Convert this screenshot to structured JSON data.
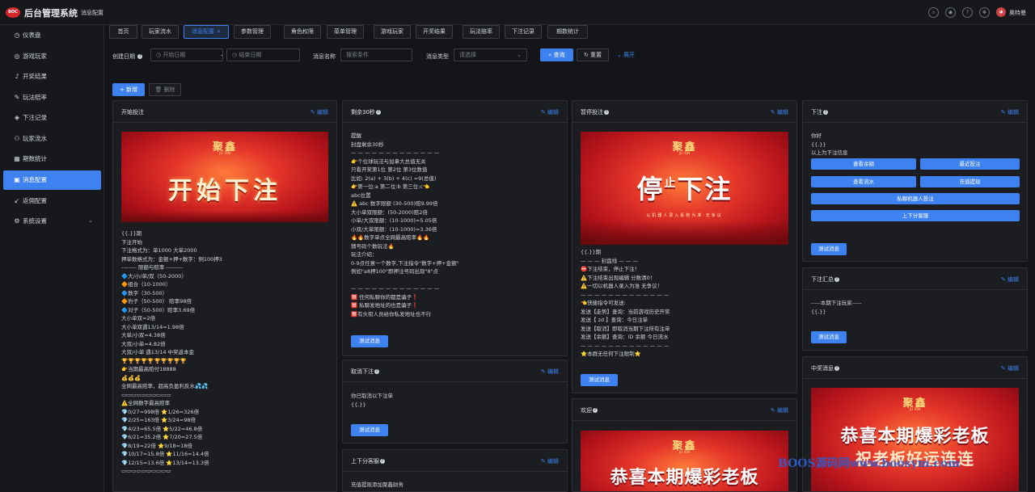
{
  "app": {
    "logo_text": "BOC",
    "title": "后台管理系统",
    "breadcrumb": "消息配置",
    "username": "奥特曼"
  },
  "topbar_icons": [
    "search-icon",
    "github-icon",
    "question-icon",
    "settings-icon"
  ],
  "sidebar": {
    "items": [
      {
        "icon": "◷",
        "label": "仪表盘"
      },
      {
        "icon": "◎",
        "label": "游戏玩家"
      },
      {
        "icon": "♪",
        "label": "开奖结果"
      },
      {
        "icon": "✎",
        "label": "玩法赔率"
      },
      {
        "icon": "◈",
        "label": "下注记录"
      },
      {
        "icon": "⚇",
        "label": "玩家流水"
      },
      {
        "icon": "▦",
        "label": "期数统计"
      },
      {
        "icon": "▣",
        "label": "消息配置"
      },
      {
        "icon": "↙",
        "label": "返佣配置"
      },
      {
        "icon": "⚙",
        "label": "系统设置"
      }
    ],
    "collapse_icon": "«"
  },
  "tabs": [
    "首页",
    "玩家流水",
    "消息配置",
    "参数管理",
    "角色权限",
    "菜单管理",
    "游戏玩家",
    "开奖结果",
    "玩法赔率",
    "下注记录",
    "期数统计"
  ],
  "filter": {
    "created_label": "创建日期",
    "start_placeholder": "开始日期",
    "separator": "-",
    "end_placeholder": "结束日期",
    "name_label": "消息名称",
    "name_placeholder": "搜索条件",
    "type_label": "消息类型",
    "type_placeholder": "请选择",
    "search_btn": "查询",
    "reset_btn": "重置",
    "expand_btn": "展开"
  },
  "actions": {
    "add": "新增",
    "delete": "删除"
  },
  "edit_label": "编辑",
  "test_btn": "测试消息",
  "cards": {
    "start": {
      "title": "开始投注",
      "banner": {
        "brand": "聚鑫",
        "brandsub": "JU XIN",
        "headline": "开始下注"
      },
      "text": "{{.}}期\n下注开始\n下注格式为：单1000 大单2000\n押单数格式为：金额+押+数字：例100押3\n-------- 限额与赔率 ---------\n🔷大/小/单/双（50-2000）\n🔶组合（10-1000）\n🔷数字（30-500）\n🔶豹子（50-500） 赔率98倍\n🔷对子（50-500）赔率3.69倍\n大小单双=2倍\n大小单双遇13/14=1.98倍\n大单/小双=4.38倍\n大双/小单=4.82倍\n大双/小单 遇13/14 中奖返本金\n🏆🏆🏆🏆🏆🏆🏆🏆🏆🏆\n👉当期最高赔付18888\n💰💰💰\n全网最高赔率，超高负盈利反水💦💦\n▭▭▭▭▭▭▭▭▭▭\n⚠️全网数字最高赔率\n💎0/27=998倍 ⭐1/26=326倍\n💎2/25=163倍 ⭐3/24=98倍\n💎4/23=65.5倍 ⭐5/22=46.8倍\n💎6/21=35.2倍 ⭐7/20=27.5倍\n💎8/19=22倍 ⭐9/18=18倍\n💎10/17=15.8倍 ⭐11/16=14.4倍\n💎12/15=13.6倍 ⭐13/14=13.3倍\n▭▭▭▭▭▭▭▭▭▭"
    },
    "remain30": {
      "title": "剩余30秒",
      "text": "提醒\n封盘剩余30秒\n— — — — — — — — — — — — —\n👉个位球玩法与加拿大总值无关\n只看开奖第1位 第2位 第3位数值\n比如: 2(a) + 3(b) + 4(c) =9(总值)\n👉第一位:a 第二位:b 第三位:c👈\nabc位置\n⚠️ abc 数字限额 (30-500)赔9.99倍\n大小单双限额：(50-2000)赔2倍\n小单/大双限额：(10-1000)=5.05倍\n小双/大单限额：(10-1000)=3.36倍\n🔥🔥数字单点全网最高赔率🔥🔥\n猜号码个数玩法🔥\n玩法介绍：\n0-9点任意一个数字,下注指令\"数字+押+金额\"\n例如\"a8押100\"即押注号码出现\"8\"点\n\n— — — — — — — — — — — — —\n🈲 任何私聊你的都是骗子❗\n🈲 私聊发地址的也是骗子❗\n🈲有头衔人员给你私发地址也不行"
    },
    "cancel": {
      "title": "取消下注",
      "text": "你已取消以下注单\n{{.}}"
    },
    "cs": {
      "title": "上下分客服",
      "text": "充值提现添加聚鑫财务"
    },
    "stop": {
      "title": "暂停投注",
      "banner": {
        "brand": "聚鑫",
        "brandsub": "JU XIN",
        "headline_a": "停",
        "headline_b": "止",
        "headline_c": "下注",
        "sub": "以机器人录入系统为准·无争议"
      },
      "text": "{{.}}期\n— — — 封盘线 — — —\n⛔下注结束，停止下注！\n⚠️下注结束出现编辑 分数清0！\n⚠️一切以机器人录入为准 无争议！\n— — — — — — — — — — — — —\n👈快捷指令可发送:\n发送【走势】查询：当前游戏历史开奖\n发送【 zd 】查询：今日注单\n发送【取消】即取消当期下注所有注单\n发送【余额】查询：ID 余额 今日流水\n— — — — — — — — — — — — —\n⭐本群无任何下注限制⭐"
    },
    "welcome": {
      "title": "欢迎",
      "banner": {
        "brand": "聚鑫",
        "brandsub": "JU XIN",
        "headline": "恭喜本期爆彩老板"
      }
    },
    "bet": {
      "title": "下注",
      "text": "你好\n{{.}}\n以上为下注信息",
      "keyboard": [
        "查看余额",
        "最近投注",
        "查看流水",
        "充值提现",
        "私聊机器人投注",
        "上下分客服"
      ]
    },
    "summary": {
      "title": "下注汇总",
      "text": "-----本期下注玩家-----\n{{.}}"
    },
    "winning": {
      "title": "中奖消息",
      "banner": {
        "brand": "聚鑫",
        "brandsub": "JU XIN",
        "headline": "恭喜本期爆彩老板",
        "headline2": "祝老板好运连连"
      }
    }
  },
  "watermark": "BOOS源码网www.boosym.com",
  "colors": {
    "accent": "#3d82f0",
    "bg": "#141518",
    "card": "#1c1d21",
    "banner_red": "#e4362a"
  }
}
